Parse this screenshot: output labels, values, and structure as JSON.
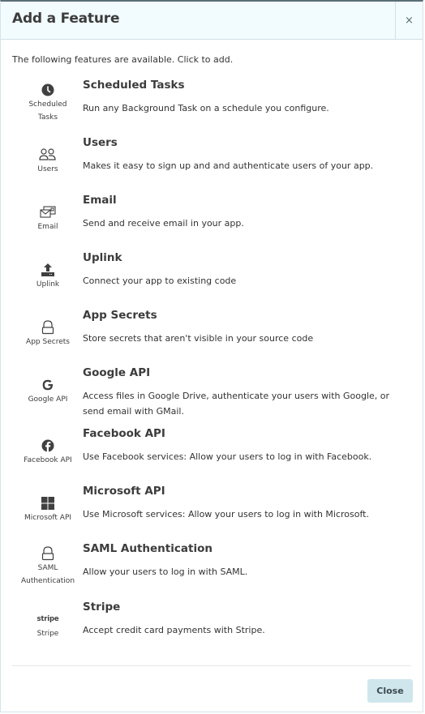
{
  "dialog": {
    "title": "Add a Feature",
    "close_icon": "×",
    "intro": "The following features are available. Click to add.",
    "close_button": "Close"
  },
  "features": [
    {
      "icon": "clock-icon",
      "icon_label_1": "Scheduled",
      "icon_label_2": "Tasks",
      "title": "Scheduled Tasks",
      "description": "Run any Background Task on a schedule you configure."
    },
    {
      "icon": "users-icon",
      "icon_label_1": "Users",
      "icon_label_2": "",
      "title": "Users",
      "description": "Makes it easy to sign up and and authenticate users of your app."
    },
    {
      "icon": "email-icon",
      "icon_label_1": "Email",
      "icon_label_2": "",
      "title": "Email",
      "description": "Send and receive email in your app."
    },
    {
      "icon": "upload-icon",
      "icon_label_1": "Uplink",
      "icon_label_2": "",
      "title": "Uplink",
      "description": "Connect your app to existing code"
    },
    {
      "icon": "lock-icon",
      "icon_label_1": "App Secrets",
      "icon_label_2": "",
      "title": "App Secrets",
      "description": "Store secrets that aren't visible in your source code"
    },
    {
      "icon": "google-icon",
      "icon_label_1": "Google API",
      "icon_label_2": "",
      "title": "Google API",
      "description": "Access files in Google Drive, authenticate your users with Google, or send email with GMail."
    },
    {
      "icon": "facebook-icon",
      "icon_label_1": "Facebook API",
      "icon_label_2": "",
      "title": "Facebook API",
      "description": "Use Facebook services: Allow your users to log in with Facebook."
    },
    {
      "icon": "microsoft-icon",
      "icon_label_1": "Microsoft API",
      "icon_label_2": "",
      "title": "Microsoft API",
      "description": "Use Microsoft services: Allow your users to log in with Microsoft."
    },
    {
      "icon": "lock-icon",
      "icon_label_1": "SAML",
      "icon_label_2": "Authentication",
      "title": "SAML Authentication",
      "description": "Allow your users to log in with SAML."
    },
    {
      "icon": "stripe-icon",
      "icon_label_1": "Stripe",
      "icon_label_2": "",
      "icon_text": "stripe",
      "title": "Stripe",
      "description": "Accept credit card payments with Stripe."
    }
  ]
}
